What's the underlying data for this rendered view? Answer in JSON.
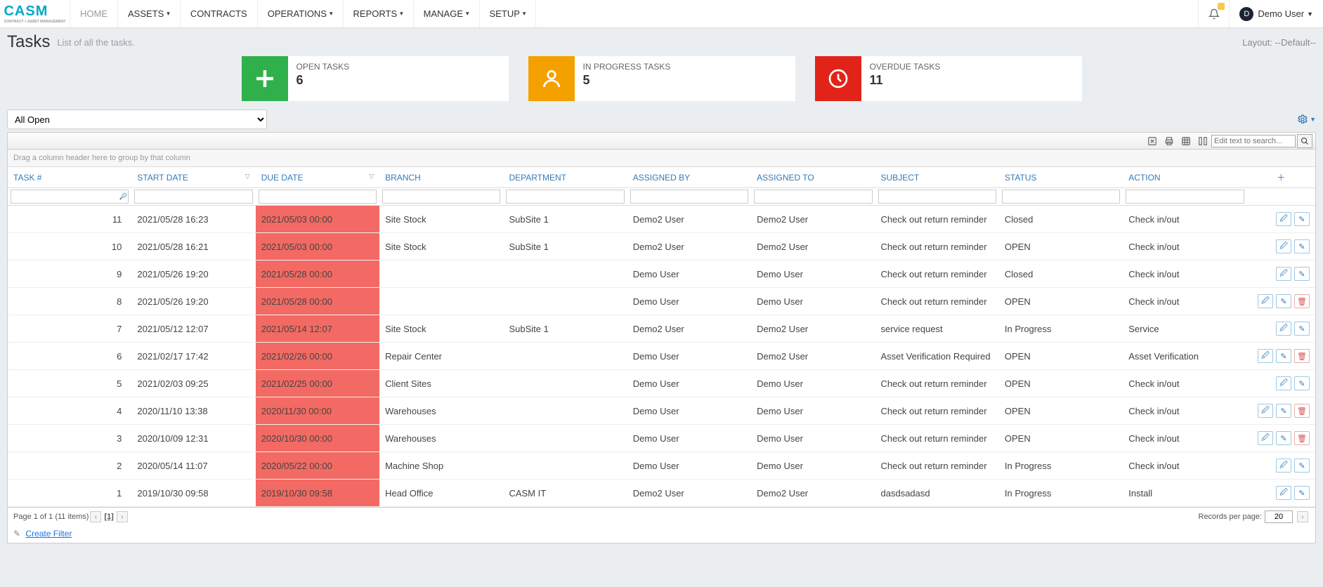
{
  "nav": {
    "logo": "CASM",
    "logo_sub": "CONTRACT + ASSET MANAGEMENT",
    "items": [
      {
        "label": "HOME",
        "dropdown": false,
        "active": true
      },
      {
        "label": "ASSETS",
        "dropdown": true
      },
      {
        "label": "CONTRACTS",
        "dropdown": false
      },
      {
        "label": "OPERATIONS",
        "dropdown": true
      },
      {
        "label": "REPORTS",
        "dropdown": true
      },
      {
        "label": "MANAGE",
        "dropdown": true
      },
      {
        "label": "SETUP",
        "dropdown": true
      }
    ],
    "user_initial": "D",
    "user_name": "Demo User"
  },
  "page": {
    "title": "Tasks",
    "subtitle": "List of all the tasks.",
    "layout_label": "Layout:",
    "layout_value": "--Default--"
  },
  "cards": {
    "open": {
      "label": "OPEN TASKS",
      "value": "6"
    },
    "inprog": {
      "label": "IN PROGRESS TASKS",
      "value": "5"
    },
    "overdue": {
      "label": "OVERDUE TASKS",
      "value": "11"
    }
  },
  "filter_select": "All Open",
  "grid": {
    "group_hint": "Drag a column header here to group by that column",
    "search_placeholder": "Edit text to search...",
    "columns": {
      "task": "TASK #",
      "start": "START DATE",
      "due": "DUE DATE",
      "branch": "BRANCH",
      "dept": "DEPARTMENT",
      "assigned_by": "ASSIGNED BY",
      "assigned_to": "ASSIGNED TO",
      "subject": "SUBJECT",
      "status": "STATUS",
      "action": "ACTION"
    },
    "rows": [
      {
        "task": "11",
        "start": "2021/05/28 16:23",
        "due": "2021/05/03 00:00",
        "overdue": true,
        "branch": "Site Stock",
        "dept": "SubSite 1",
        "by": "Demo2 User",
        "to": "Demo2 User",
        "subject": "Check out return reminder",
        "status": "Closed",
        "action": "Check in/out",
        "del": false
      },
      {
        "task": "10",
        "start": "2021/05/28 16:21",
        "due": "2021/05/03 00:00",
        "overdue": true,
        "branch": "Site Stock",
        "dept": "SubSite 1",
        "by": "Demo2 User",
        "to": "Demo2 User",
        "subject": "Check out return reminder",
        "status": "OPEN",
        "action": "Check in/out",
        "del": false
      },
      {
        "task": "9",
        "start": "2021/05/26 19:20",
        "due": "2021/05/28 00:00",
        "overdue": true,
        "branch": "",
        "dept": "",
        "by": "Demo User",
        "to": "Demo User",
        "subject": "Check out return reminder",
        "status": "Closed",
        "action": "Check in/out",
        "del": false
      },
      {
        "task": "8",
        "start": "2021/05/26 19:20",
        "due": "2021/05/28 00:00",
        "overdue": true,
        "branch": "",
        "dept": "",
        "by": "Demo User",
        "to": "Demo User",
        "subject": "Check out return reminder",
        "status": "OPEN",
        "action": "Check in/out",
        "del": true
      },
      {
        "task": "7",
        "start": "2021/05/12 12:07",
        "due": "2021/05/14 12:07",
        "overdue": true,
        "branch": "Site Stock",
        "dept": "SubSite 1",
        "by": "Demo2 User",
        "to": "Demo2 User",
        "subject": "service request",
        "status": "In Progress",
        "action": "Service",
        "del": false
      },
      {
        "task": "6",
        "start": "2021/02/17 17:42",
        "due": "2021/02/26 00:00",
        "overdue": true,
        "branch": "Repair Center",
        "dept": "",
        "by": "Demo User",
        "to": "Demo2 User",
        "subject": "Asset Verification Required",
        "status": "OPEN",
        "action": "Asset Verification",
        "del": true
      },
      {
        "task": "5",
        "start": "2021/02/03 09:25",
        "due": "2021/02/25 00:00",
        "overdue": true,
        "branch": "Client Sites",
        "dept": "",
        "by": "Demo User",
        "to": "Demo User",
        "subject": "Check out return reminder",
        "status": "OPEN",
        "action": "Check in/out",
        "del": false
      },
      {
        "task": "4",
        "start": "2020/11/10 13:38",
        "due": "2020/11/30 00:00",
        "overdue": true,
        "branch": "Warehouses",
        "dept": "",
        "by": "Demo User",
        "to": "Demo User",
        "subject": "Check out return reminder",
        "status": "OPEN",
        "action": "Check in/out",
        "del": true
      },
      {
        "task": "3",
        "start": "2020/10/09 12:31",
        "due": "2020/10/30 00:00",
        "overdue": true,
        "branch": "Warehouses",
        "dept": "",
        "by": "Demo User",
        "to": "Demo User",
        "subject": "Check out return reminder",
        "status": "OPEN",
        "action": "Check in/out",
        "del": true
      },
      {
        "task": "2",
        "start": "2020/05/14 11:07",
        "due": "2020/05/22 00:00",
        "overdue": true,
        "branch": "Machine Shop",
        "dept": "",
        "by": "Demo User",
        "to": "Demo User",
        "subject": "Check out return reminder",
        "status": "In Progress",
        "action": "Check in/out",
        "del": false
      },
      {
        "task": "1",
        "start": "2019/10/30 09:58",
        "due": "2019/10/30 09:58",
        "overdue": true,
        "branch": "Head Office",
        "dept": "CASM IT",
        "by": "Demo2 User",
        "to": "Demo2 User",
        "subject": "dasdsadasd",
        "status": "In Progress",
        "action": "Install",
        "del": false
      }
    ],
    "pager_text": "Page 1 of 1 (11 items)",
    "rpp_label": "Records per page:",
    "rpp_value": "20",
    "create_filter": "Create Filter"
  }
}
